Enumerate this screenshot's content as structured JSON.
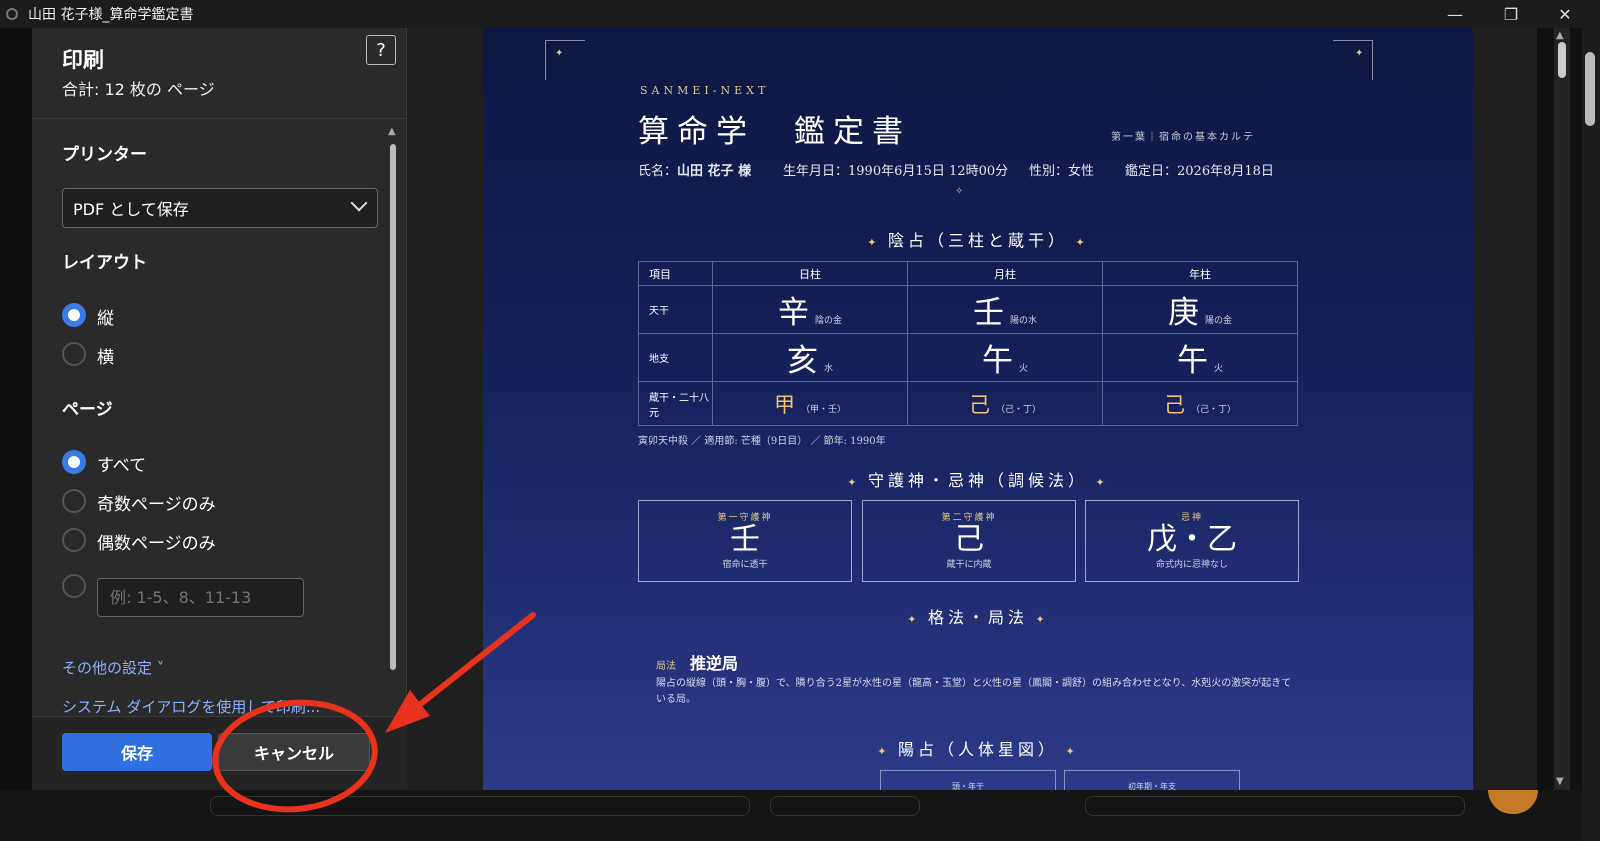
{
  "window": {
    "title": "山田 花子様_算命学鑑定書",
    "controls": [
      "—",
      "❐",
      "✕"
    ]
  },
  "print_panel": {
    "title": "印刷",
    "summary": "合計: 12 枚の ページ",
    "help_label": "?",
    "printer_label": "プリンター",
    "printer_value": "PDF として保存",
    "layout_label": "レイアウト",
    "layout_options": [
      "縦",
      "横"
    ],
    "layout_selected": "縦",
    "pages_label": "ページ",
    "pages_options": [
      "すべて",
      "奇数ページのみ",
      "偶数ページのみ"
    ],
    "pages_selected": "すべて",
    "range_placeholder": "例: 1-5、8、11-13",
    "more_settings": "その他の設定 ˅",
    "system_dialog": "システム ダイアログを使用して印刷...",
    "save_button": "保存",
    "cancel_button": "キャンセル"
  },
  "preview": {
    "brand": "SANMEI-NEXT",
    "title": "算命学　鑑定書",
    "subtitle": "第一葉｜宿命の基本カルテ",
    "name_label": "氏名：",
    "name_value": "山田 花子 様",
    "birth": "生年月日：1990年6月15日 12時00分",
    "gender": "性別：女性",
    "date": "鑑定日：2026年8月18日",
    "divider": "✧",
    "sec1": "陰占（三柱と蔵干）",
    "table": {
      "headers": [
        "項目",
        "日柱",
        "月柱",
        "年柱"
      ],
      "rows": [
        {
          "label": "天干",
          "cells": [
            {
              "main": "辛",
              "sub": "陰の金"
            },
            {
              "main": "壬",
              "sub": "陽の水"
            },
            {
              "main": "庚",
              "sub": "陽の金"
            }
          ]
        },
        {
          "label": "地支",
          "cells": [
            {
              "main": "亥",
              "sub": "水"
            },
            {
              "main": "午",
              "sub": "火"
            },
            {
              "main": "午",
              "sub": "火"
            }
          ]
        },
        {
          "label": "蔵干・二十八元",
          "cells": [
            {
              "main": "甲",
              "sub": "（甲・壬）"
            },
            {
              "main": "己",
              "sub": "（己・丁）"
            },
            {
              "main": "己",
              "sub": "（己・丁）"
            }
          ]
        }
      ]
    },
    "note": "寅卯天中殺 ／ 適用節: 芒種（9日目） ／ 節年: 1990年",
    "sec2": "守護神・忌神（調候法）",
    "guardians": [
      {
        "head": "第一守護神",
        "glyph": "壬",
        "sub": "宿命に透干"
      },
      {
        "head": "第二守護神",
        "glyph": "己",
        "sub": "蔵干に内蔵"
      },
      {
        "head": "忌神",
        "glyph": "戊・乙",
        "sub": "命式内に忌神なし"
      }
    ],
    "sec3": "格法・局法",
    "kyoku_label": "局法",
    "kyoku_name": "推逆局",
    "kyoku_desc": "陽占の縦線（頭・胸・腹）で、隣り合う2星が水性の星（龍高・玉堂）と火性の星（鳳閣・調舒）の組み合わせとなり、水剋火の激突が起きている局。",
    "sec4": "陽占（人体星図）",
    "jintai_boxes": [
      "頭・年干",
      "初年期・年支"
    ]
  },
  "colors": {
    "accent_blue": "#2f6fe0",
    "annotation_red": "#e8321e",
    "doc_gold": "#e8c886"
  }
}
